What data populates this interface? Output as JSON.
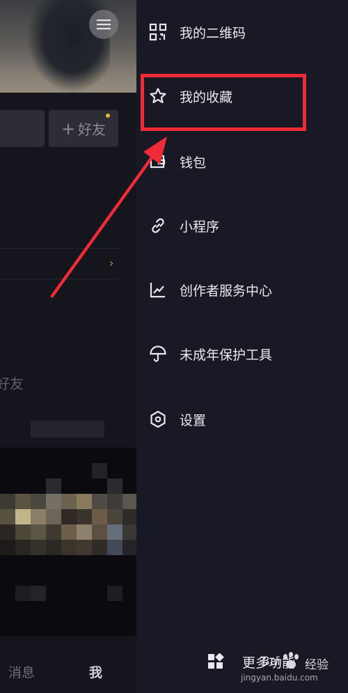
{
  "profile": {
    "add_friend_label": "好友",
    "friend_hint": "好友",
    "bottom_nav": {
      "messages": "消息",
      "me": "我"
    }
  },
  "drawer": {
    "items": [
      {
        "label": "我的二维码",
        "icon": "qr-code-icon"
      },
      {
        "label": "我的收藏",
        "icon": "star-icon"
      },
      {
        "label": "钱包",
        "icon": "wallet-icon"
      },
      {
        "label": "小程序",
        "icon": "link-icon"
      },
      {
        "label": "创作者服务中心",
        "icon": "chart-icon"
      },
      {
        "label": "未成年保护工具",
        "icon": "umbrella-icon"
      },
      {
        "label": "设置",
        "icon": "hexagon-settings-icon"
      }
    ],
    "more_label": "更多功能"
  },
  "watermark": {
    "brand_left": "Bai",
    "brand_right": "经验",
    "url": "jingyan.baidu.com"
  },
  "colors": {
    "drawer_bg": "#181925",
    "highlight": "#ee2b36",
    "accent_dot": "#e7b43a"
  }
}
